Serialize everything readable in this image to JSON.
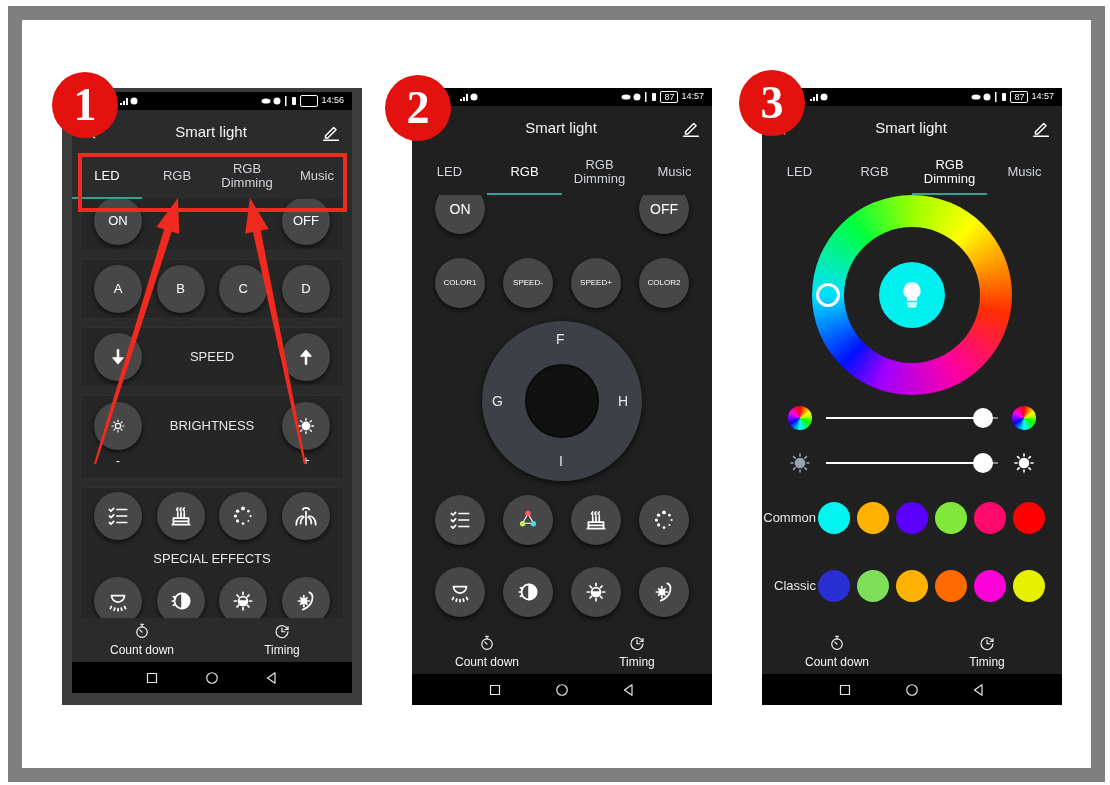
{
  "panels": [
    {
      "kind": "led",
      "badge": "1",
      "time": "14:56",
      "title": "Smart light",
      "tabs_highlighted": true,
      "tabs": [
        {
          "label": "LED",
          "selected": true
        },
        {
          "label": "RGB",
          "selected": false
        },
        {
          "label": "RGB Dimming",
          "selected": false
        },
        {
          "label": "Music",
          "selected": false
        }
      ],
      "power": [
        "ON",
        "OFF"
      ],
      "keys": [
        "A",
        "B",
        "C",
        "D"
      ],
      "speed_label": "SPEED",
      "brightness": {
        "label": "BRIGHTNESS",
        "minus": "-",
        "plus": "+"
      },
      "effects_label": "SPECIAL EFFECTS",
      "footer": [
        "Count down",
        "Timing"
      ]
    },
    {
      "kind": "rgb",
      "badge": "2",
      "time": "14:57",
      "battery": "87",
      "title": "Smart light",
      "tabs_highlighted": false,
      "tabs": [
        {
          "label": "LED",
          "selected": false
        },
        {
          "label": "RGB",
          "selected": true
        },
        {
          "label": "RGB Dimming",
          "selected": false
        },
        {
          "label": "Music",
          "selected": false
        }
      ],
      "power": [
        "ON",
        "OFF"
      ],
      "keys": [
        "COLOR1",
        "SPEED-",
        "SPEED+",
        "COLOR2"
      ],
      "pad": [
        "F",
        "G",
        "H",
        "I"
      ],
      "footer": [
        "Count down",
        "Timing"
      ]
    },
    {
      "kind": "dimming",
      "badge": "3",
      "time": "14:57",
      "battery": "87",
      "title": "Smart light",
      "tabs_highlighted": false,
      "tabs": [
        {
          "label": "LED",
          "selected": false
        },
        {
          "label": "RGB",
          "selected": false
        },
        {
          "label": "RGB Dimming",
          "selected": true
        },
        {
          "label": "Music",
          "selected": false
        }
      ],
      "sliders": [
        {
          "kind": "hue",
          "level": 0.97
        },
        {
          "kind": "brightness",
          "level": 0.97
        }
      ],
      "palettes": [
        {
          "label": "Common",
          "colors": [
            {
              "color": "#00f5f0"
            },
            {
              "color": "#ffb300"
            },
            {
              "color": "#5b00ff"
            },
            {
              "color": "#7fe83a"
            },
            {
              "color": "#ff0a6c"
            },
            {
              "color": "#ff0000"
            }
          ]
        },
        {
          "label": "Classic",
          "colors": [
            {
              "color": "#2a2fd4"
            },
            {
              "color": "#7ee05a"
            },
            {
              "color": "#ffb300"
            },
            {
              "color": "#ff6a00"
            },
            {
              "color": "#ff00d8"
            },
            {
              "color": "#e6f000"
            }
          ]
        }
      ],
      "footer": [
        "Count down",
        "Timing"
      ]
    }
  ]
}
